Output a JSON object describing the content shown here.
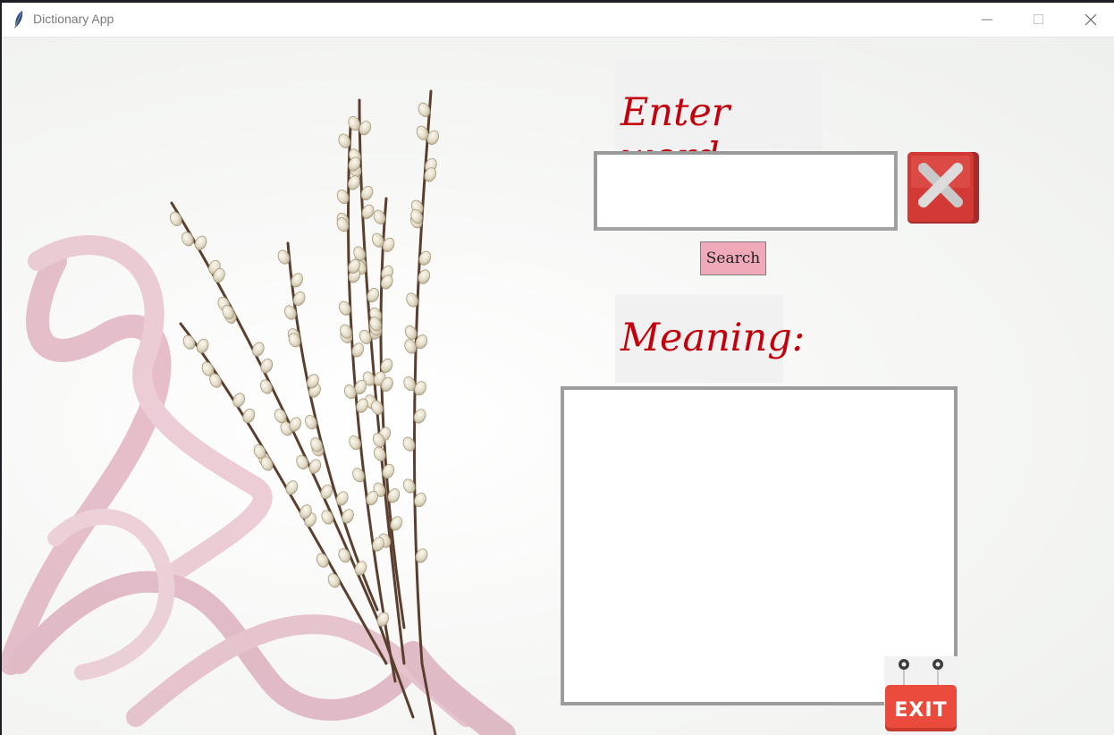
{
  "window": {
    "title": "Dictionary App",
    "controls": {
      "minimize": "minimize-icon",
      "maximize": "maximize-icon",
      "close": "close-icon"
    }
  },
  "main": {
    "word_label": "Enter word:",
    "word_input_value": "",
    "search_label": "Search",
    "meaning_label": "Meaning:",
    "meaning_value": "",
    "clear_icon": "x-icon",
    "exit_label": "EXIT"
  },
  "colors": {
    "heading": "#c4000d",
    "search_button": "#efa9b8",
    "clear_button": "#d33a36",
    "exit_button": "#ea4b3c"
  }
}
